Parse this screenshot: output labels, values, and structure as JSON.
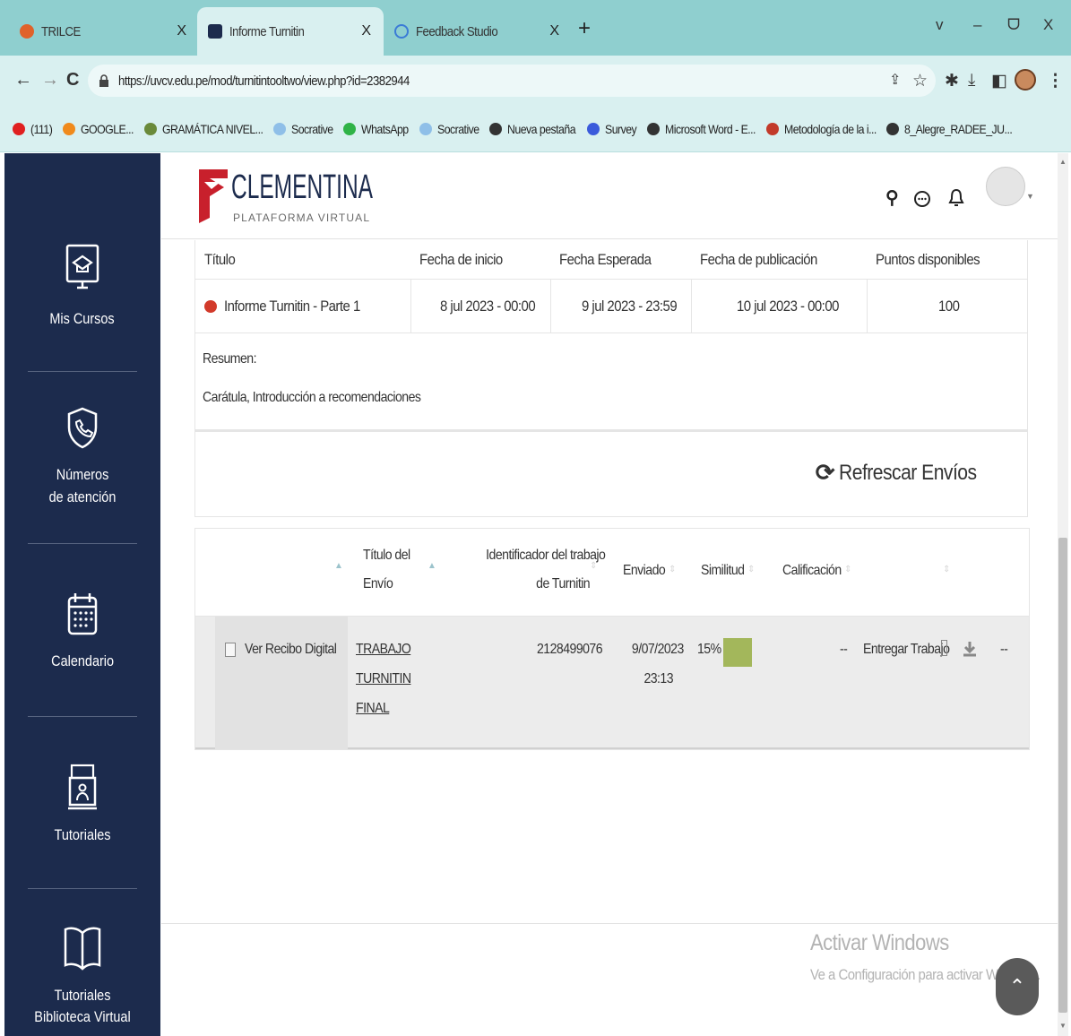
{
  "browser": {
    "tabs": [
      {
        "label": "TRILCE",
        "close": "X"
      },
      {
        "label": "Informe Turnitin",
        "close": "X"
      },
      {
        "label": "Feedback Studio",
        "close": "X"
      }
    ],
    "new_tab": "+",
    "window_controls": {
      "menu": "v",
      "minimize": "–",
      "restore": "ᗜ",
      "close": "X"
    },
    "url": "https://uvcv.edu.pe/mod/turnitintooltwo/view.php?id=2382944",
    "bookmarks": [
      {
        "label": "(111)",
        "icon": "youtube-icon",
        "color": "#e02020"
      },
      {
        "label": "GOOGLE...",
        "icon": "flame-icon",
        "color": "#f08a1c"
      },
      {
        "label": "GRAMÁTICA NIVEL...",
        "icon": "globe-icon",
        "color": "#6a8a3a"
      },
      {
        "label": "Socrative",
        "icon": "socrative-icon",
        "color": "#8fbfe8"
      },
      {
        "label": "WhatsApp",
        "icon": "whatsapp-icon",
        "color": "#2fb347"
      },
      {
        "label": "Socrative",
        "icon": "socrative-icon",
        "color": "#8fbfe8"
      },
      {
        "label": "Nueva pestaña",
        "icon": "globe-icon",
        "color": "#333333"
      },
      {
        "label": "Survey",
        "icon": "survey-icon",
        "color": "#3b5bdb"
      },
      {
        "label": "Microsoft Word - E...",
        "icon": "globe-icon",
        "color": "#333333"
      },
      {
        "label": "Metodología de la i...",
        "icon": "ucv-icon",
        "color": "#c23a2a"
      },
      {
        "label": "8_Alegre_RADEE_JU...",
        "icon": "globe-icon",
        "color": "#333333"
      }
    ]
  },
  "sidebar": {
    "items": [
      {
        "label": "Mis Cursos",
        "icon": "monitor-graduation-icon"
      },
      {
        "label": "Números de atención",
        "icon": "phone-shield-icon"
      },
      {
        "label": "Calendario",
        "icon": "calendar-icon"
      },
      {
        "label": "Tutoriales",
        "icon": "tutorial-board-icon"
      },
      {
        "label": "Tutoriales Biblioteca Virtual",
        "icon": "book-icon"
      }
    ],
    "color": "#1c2b4d"
  },
  "header": {
    "logo_title": "CLEMENTINA",
    "logo_subtitle": "PLATAFORMA VIRTUAL",
    "logo_color": "#c8202c"
  },
  "assignment": {
    "columns": [
      "Título",
      "Fecha de inicio",
      "Fecha Esperada",
      "Fecha de publicación",
      "Puntos disponibles"
    ],
    "row": {
      "title": "Informe Turnitin - Parte 1",
      "start": "8 jul 2023 - 00:00",
      "due": "9 jul 2023 - 23:59",
      "post": "10 jul 2023 - 00:00",
      "points": "100"
    },
    "summary_label": "Resumen:",
    "summary_text": "Carátula, Introducción a recomendaciones"
  },
  "refresh_label": "Refrescar Envíos",
  "submissions": {
    "headers": {
      "title_l1": "Título del",
      "title_l2": "Envío",
      "id_l1": "Identificador del trabajo",
      "id_l2": "de Turnitin",
      "sent": "Enviado",
      "similarity": "Similitud",
      "grade": "Calificación"
    },
    "row": {
      "receipt": "Ver Recibo Digital",
      "title_l1": "TRABAJO",
      "title_l2": "TURNITIN",
      "title_l3": "FINAL",
      "id": "2128499076",
      "date": "9/07/2023",
      "time": "23:13",
      "similarity": "15%",
      "similarity_color": "#a3b75b",
      "grade": "--",
      "action": "Entregar Trabajo",
      "last": "--"
    }
  },
  "watermark": {
    "line1": "Activar Windows",
    "line2": "Ve a Configuración para activar Windows."
  }
}
